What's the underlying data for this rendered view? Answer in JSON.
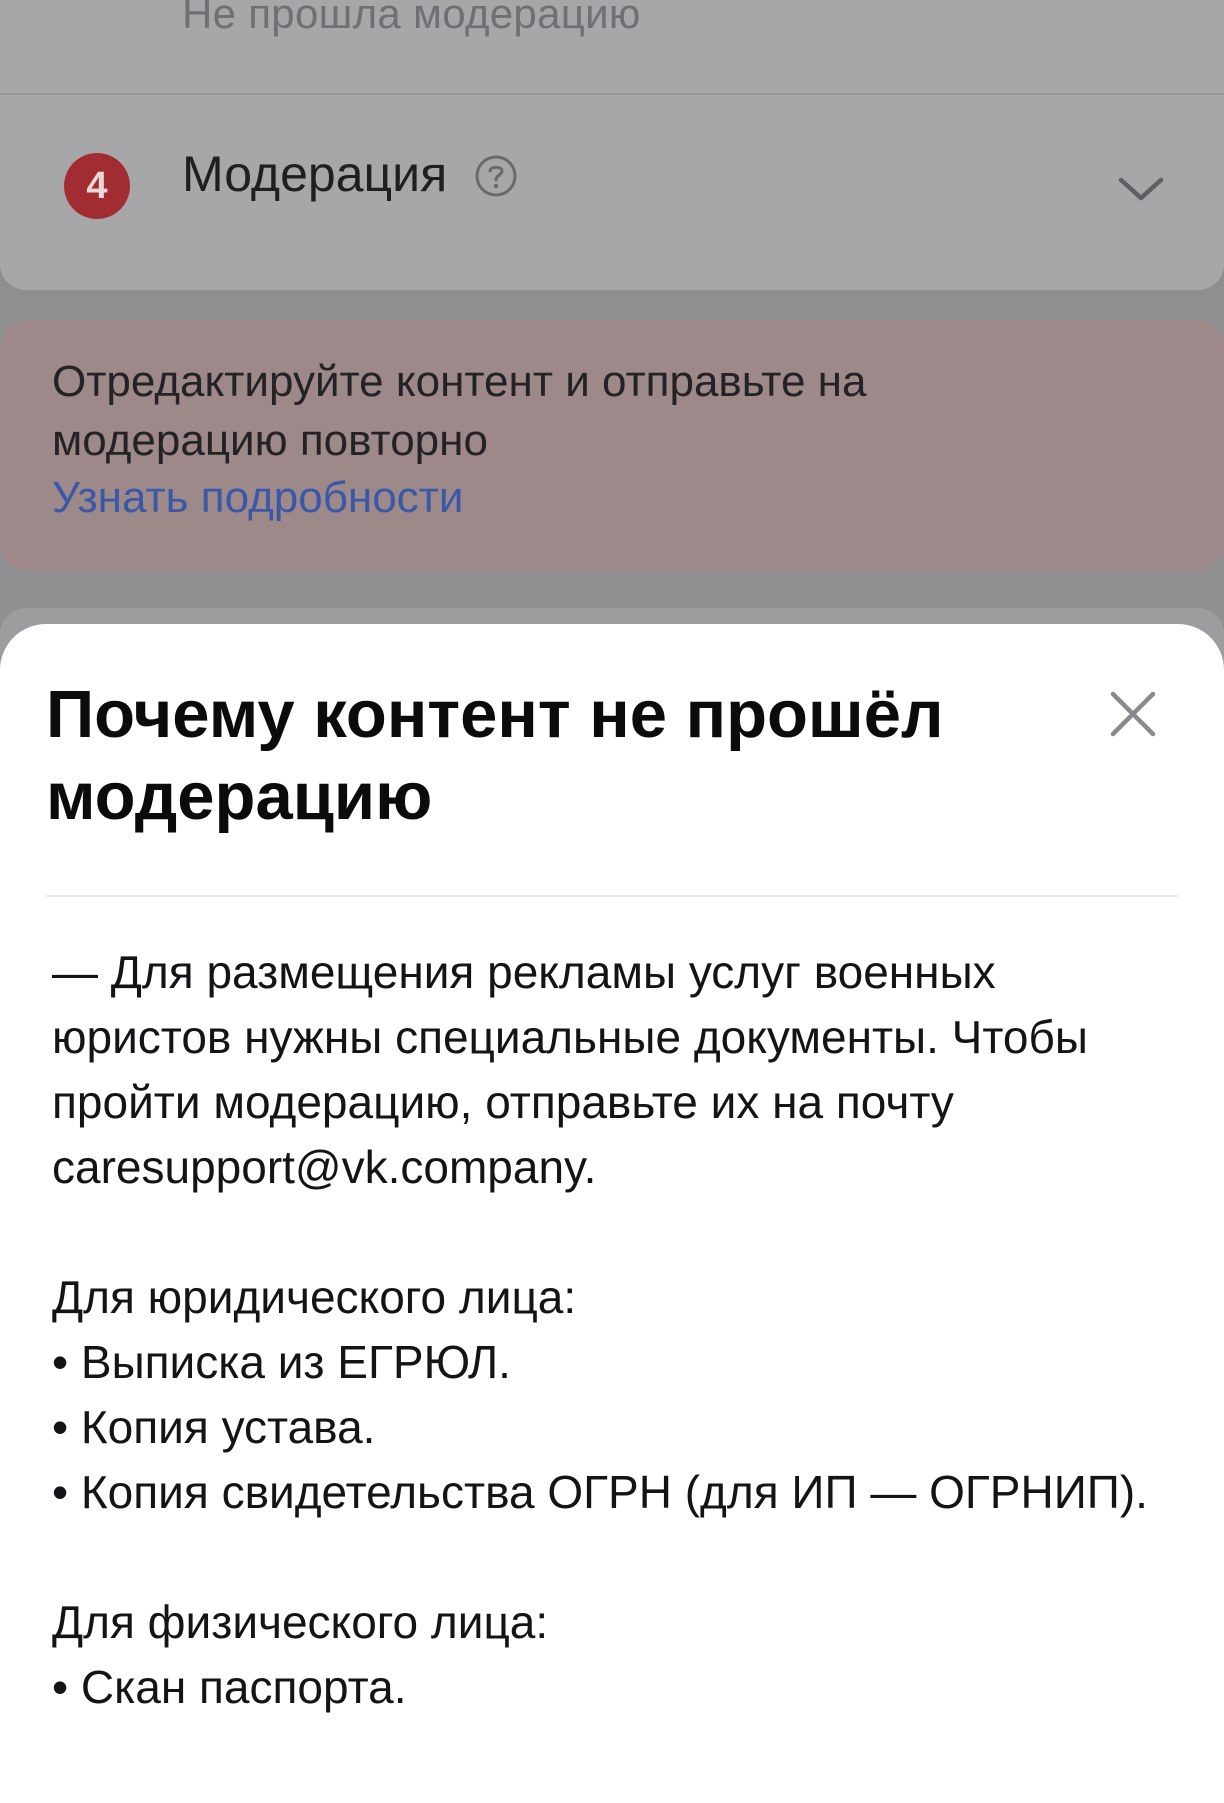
{
  "background": {
    "status_line": "Не прошла модерацию",
    "step": {
      "number": "4",
      "title": "Модерация"
    },
    "notice": {
      "text": "Отредактируйте контент и отправьте на модерацию повторно",
      "link": "Узнать подробности"
    }
  },
  "sheet": {
    "title": "Почему контент не прошёл модерацию",
    "body": {
      "intro": "— Для размещения рекламы услуг военных юристов нужны специальные документы. Чтобы пройти модерацию, отправьте их на почту caresupport@vk.company.",
      "legal_heading": "Для юридического лица:",
      "legal_items": [
        "Выписка из ЕГРЮЛ.",
        "Копия устава.",
        "Копия свидетельства ОГРН (для ИП — ОГРНИП)."
      ],
      "individual_heading": "Для физического лица:",
      "individual_items": [
        "Скан паспорта."
      ]
    }
  },
  "colors": {
    "overlay": "#8f8f91",
    "badge": "#a12d33",
    "link": "#3a58a8",
    "notice_bg": "#9d898a",
    "sheet_bg": "#ffffff"
  },
  "icons": {
    "help": "help-circle-icon",
    "chevron": "chevron-down-icon",
    "close": "close-icon"
  }
}
